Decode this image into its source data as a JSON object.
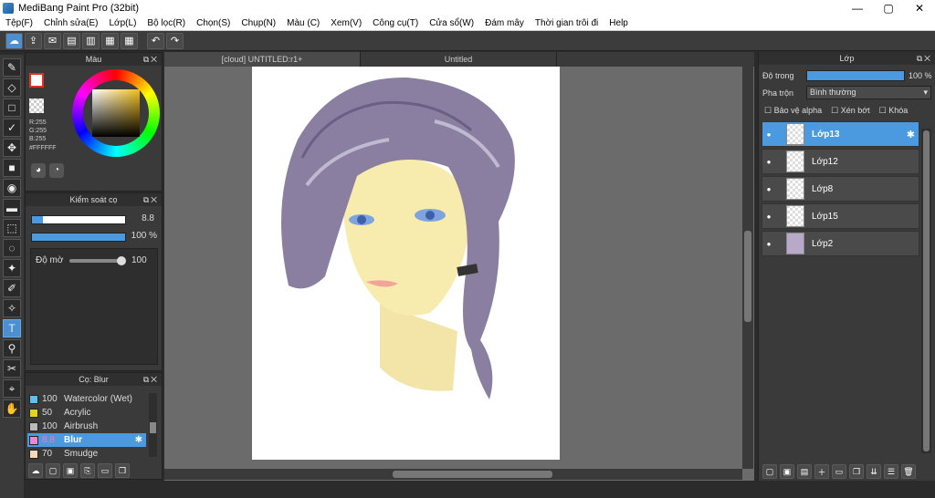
{
  "window": {
    "title": "MediBang Paint Pro (32bit)",
    "min": "—",
    "max": "▢",
    "close": "✕"
  },
  "menu": [
    "Tệp(F)",
    "Chỉnh sửa(E)",
    "Lớp(L)",
    "Bộ lọc(R)",
    "Chọn(S)",
    "Chụp(N)",
    "Màu (C)",
    "Xem(V)",
    "Công cụ(T)",
    "Cửa sổ(W)",
    "Đám mây",
    "Thời gian trôi đi",
    "Help"
  ],
  "color_panel": {
    "title": "Màu",
    "r": "R:255",
    "g": "G:255",
    "b": "B:255",
    "hex": "#FFFFFF"
  },
  "brush_control": {
    "title": "Kiểm soát cọ",
    "size": "8.8",
    "opacity_pct": "100 %",
    "opacity_label": "Độ mờ",
    "opacity_value": "100",
    "size_fill": 0.12,
    "opacity_fill": 1.0
  },
  "brush_panel": {
    "title": "Cọ: Blur",
    "items": [
      {
        "size": "100",
        "name": "Watercolor (Wet)",
        "color": "#5bc2f0"
      },
      {
        "size": "50",
        "name": "Acrylic",
        "color": "#e6d21a"
      },
      {
        "size": "100",
        "name": "Airbrush",
        "color": "#bbbbbb"
      },
      {
        "size": "8.8",
        "name": "Blur",
        "color": "#e08ad8"
      },
      {
        "size": "70",
        "name": "Smudge",
        "color": "#f4d9b8"
      }
    ]
  },
  "tabs": [
    "[cloud] UNTITLED:r1+",
    "Untitled"
  ],
  "layer_panel": {
    "title": "Lớp",
    "opacity_label": "Độ trong",
    "opacity_value": "100 %",
    "blend_label": "Pha trộn",
    "blend_value": "Bình thường",
    "protect_alpha": "Bảo vệ alpha",
    "clip": "Xén bớt",
    "lock": "Khóa",
    "layers": [
      {
        "name": "Lớp13",
        "selected": true
      },
      {
        "name": "Lớp12",
        "selected": false
      },
      {
        "name": "Lớp8",
        "selected": false
      },
      {
        "name": "Lớp15",
        "selected": false
      },
      {
        "name": "Lớp2",
        "selected": false
      }
    ]
  },
  "colors": {
    "accent": "#4b9ae0"
  }
}
